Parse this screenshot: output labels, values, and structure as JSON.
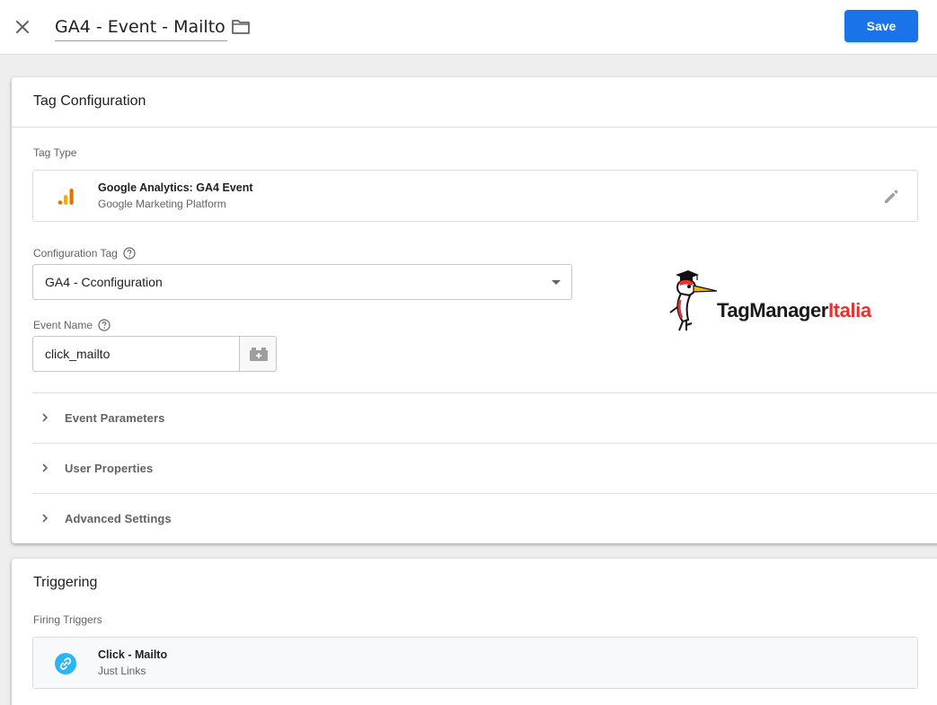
{
  "topbar": {
    "title": "GA4 - Event - Mailto",
    "save_label": "Save",
    "accent_color": "#1a73e8"
  },
  "tag_config": {
    "header": "Tag Configuration",
    "tag_type_label": "Tag Type",
    "tag_type": {
      "name": "Google Analytics: GA4 Event",
      "platform": "Google Marketing Platform",
      "icon": "analytics-bars-icon"
    },
    "configuration_tag_label": "Configuration Tag",
    "configuration_tag_value": "GA4 - Cconfiguration",
    "event_name_label": "Event Name",
    "event_name_value": "click_mailto",
    "sections": [
      {
        "label": "Event Parameters"
      },
      {
        "label": "User Properties"
      },
      {
        "label": "Advanced Settings"
      }
    ]
  },
  "logo": {
    "text_main": "TagManager",
    "text_accent": "Italia",
    "accent_color": "#e5322d"
  },
  "triggering": {
    "header": "Triggering",
    "firing_triggers_label": "Firing Triggers",
    "trigger": {
      "name": "Click - Mailto",
      "type": "Just Links",
      "icon": "link-icon",
      "icon_color": "#29b6f6"
    }
  }
}
